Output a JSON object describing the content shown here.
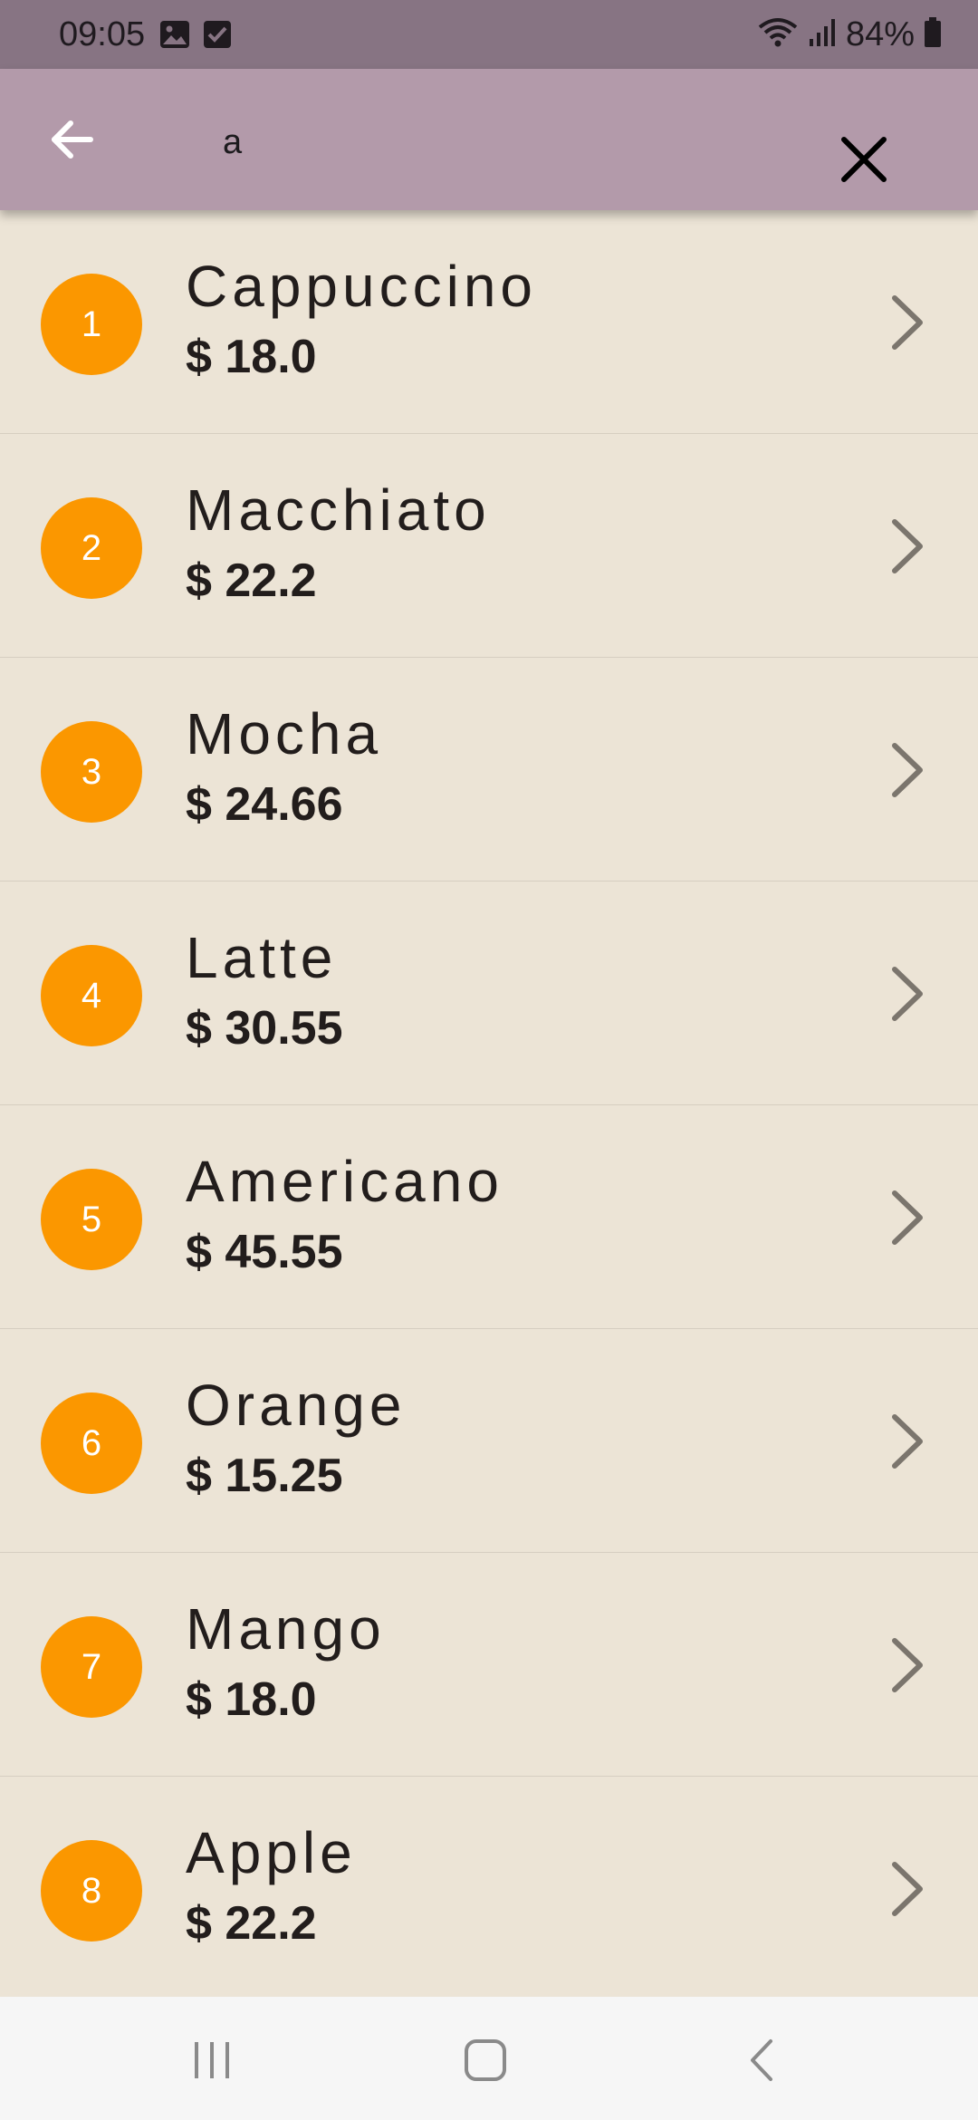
{
  "status_bar": {
    "time": "09:05",
    "battery_percent": "84%",
    "icons": [
      "image-icon",
      "checkbox-icon",
      "wifi-icon",
      "signal-icon",
      "battery-icon"
    ]
  },
  "app_bar": {
    "back_icon": "arrow-left-icon",
    "search_value": "a",
    "clear_icon": "close-icon",
    "background_color": "#b39aaa"
  },
  "items": [
    {
      "index": "1",
      "name": "Cappuccino",
      "price": "$ 18.0"
    },
    {
      "index": "2",
      "name": "Macchiato",
      "price": "$ 22.2"
    },
    {
      "index": "3",
      "name": "Mocha",
      "price": "$ 24.66"
    },
    {
      "index": "4",
      "name": "Latte",
      "price": "$ 30.55"
    },
    {
      "index": "5",
      "name": "Americano",
      "price": "$ 45.55"
    },
    {
      "index": "6",
      "name": "Orange",
      "price": "$ 15.25"
    },
    {
      "index": "7",
      "name": "Mango",
      "price": "$ 18.0"
    },
    {
      "index": "8",
      "name": "Apple",
      "price": "$ 22.2"
    }
  ],
  "colors": {
    "list_background": "#ece4d6",
    "avatar": "#fb9700",
    "status_bar": "#877483"
  },
  "nav_bar": {
    "icons": [
      "recent-apps-icon",
      "home-icon",
      "back-icon"
    ]
  }
}
